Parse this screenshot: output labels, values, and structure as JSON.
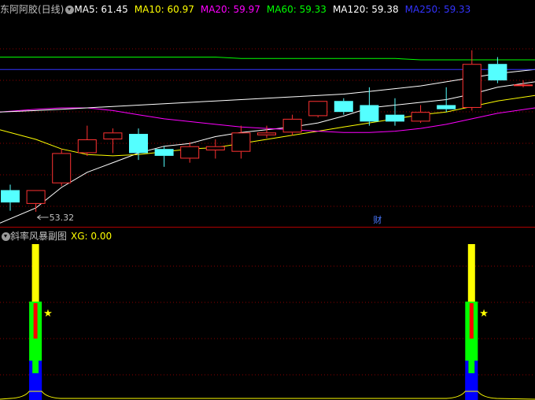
{
  "main_panel": {
    "title": "东阿阿胶(日线)",
    "ma_labels": [
      {
        "text": "MA5: 61.45",
        "color": "#ffffff"
      },
      {
        "text": "MA10: 60.97",
        "color": "#ffff00"
      },
      {
        "text": "MA20: 59.97",
        "color": "#ff00ff"
      },
      {
        "text": "MA60: 59.33",
        "color": "#00ff00"
      },
      {
        "text": "MA120: 59.38",
        "color": "#ffffff"
      },
      {
        "text": "MA250: 59.33",
        "color": "#3333ff"
      }
    ],
    "min_price_label": "53.32",
    "finance_marker": "财"
  },
  "sub_panel": {
    "title": "斜率风暴副图",
    "xg_label": "XG: 0.00"
  },
  "colors": {
    "up": "#ff3232",
    "down": "#54ffff",
    "grid": "#8b0000",
    "title": "#c0c0c0",
    "xg": "#ffff00"
  },
  "chart_data": {
    "type": "candlestick",
    "title": "东阿阿胶(日线)",
    "price_range": [
      52.4,
      67.5
    ],
    "min_label": 53.32,
    "candles": [
      {
        "o": 54.9,
        "h": 55.3,
        "l": 53.4,
        "c": 54.0
      },
      {
        "o": 53.9,
        "h": 54.9,
        "l": 53.32,
        "c": 54.9
      },
      {
        "o": 55.4,
        "h": 57.9,
        "l": 55.2,
        "c": 57.6
      },
      {
        "o": 57.6,
        "h": 59.6,
        "l": 57.4,
        "c": 58.6
      },
      {
        "o": 58.6,
        "h": 59.4,
        "l": 57.6,
        "c": 59.1
      },
      {
        "o": 59.0,
        "h": 59.4,
        "l": 57.1,
        "c": 57.6
      },
      {
        "o": 57.9,
        "h": 58.1,
        "l": 56.6,
        "c": 57.4
      },
      {
        "o": 57.2,
        "h": 58.4,
        "l": 56.9,
        "c": 58.1
      },
      {
        "o": 57.8,
        "h": 58.6,
        "l": 57.2,
        "c": 58.1
      },
      {
        "o": 57.7,
        "h": 59.6,
        "l": 57.2,
        "c": 59.1
      },
      {
        "o": 58.9,
        "h": 59.6,
        "l": 58.7,
        "c": 59.1
      },
      {
        "o": 59.1,
        "h": 60.4,
        "l": 58.9,
        "c": 60.1
      },
      {
        "o": 60.3,
        "h": 61.4,
        "l": 60.2,
        "c": 61.4
      },
      {
        "o": 61.4,
        "h": 61.6,
        "l": 60.4,
        "c": 60.6
      },
      {
        "o": 61.1,
        "h": 62.4,
        "l": 59.6,
        "c": 59.9
      },
      {
        "o": 60.4,
        "h": 61.6,
        "l": 59.6,
        "c": 59.9
      },
      {
        "o": 59.9,
        "h": 61.1,
        "l": 59.8,
        "c": 60.6
      },
      {
        "o": 61.1,
        "h": 62.4,
        "l": 60.6,
        "c": 60.8
      },
      {
        "o": 60.9,
        "h": 65.1,
        "l": 60.7,
        "c": 64.1
      },
      {
        "o": 64.1,
        "h": 64.6,
        "l": 62.7,
        "c": 62.9
      },
      {
        "o": 62.6,
        "h": 62.9,
        "l": 62.4,
        "c": 62.6
      }
    ],
    "ma": [
      {
        "name": "MA5",
        "color": "#ffffff",
        "values": [
          52.5,
          53.6,
          55.1,
          56.2,
          56.9,
          57.6,
          58.1,
          58.3,
          58.8,
          59.1,
          59.3,
          59.5,
          59.8,
          60.3,
          60.9,
          61.1,
          61.3,
          61.5,
          61.9,
          62.4,
          62.8
        ]
      },
      {
        "name": "MA10",
        "color": "#ffff00",
        "values": [
          59.3,
          58.6,
          57.9,
          57.5,
          57.4,
          57.5,
          57.7,
          57.9,
          58.0,
          58.3,
          58.6,
          58.9,
          59.2,
          59.5,
          59.8,
          60.1,
          60.4,
          60.6,
          61.0,
          61.4,
          61.8
        ]
      },
      {
        "name": "MA20",
        "color": "#ff00ff",
        "values": [
          60.6,
          60.8,
          60.9,
          60.9,
          60.7,
          60.4,
          60.1,
          59.9,
          59.7,
          59.5,
          59.4,
          59.3,
          59.2,
          59.1,
          59.1,
          59.2,
          59.4,
          59.7,
          60.1,
          60.5,
          60.9
        ]
      },
      {
        "name": "MA60",
        "color": "#00ff00",
        "values": [
          64.6,
          64.6,
          64.6,
          64.6,
          64.6,
          64.6,
          64.6,
          64.6,
          64.6,
          64.5,
          64.5,
          64.5,
          64.5,
          64.5,
          64.5,
          64.5,
          64.4,
          64.4,
          64.4,
          64.4,
          64.4
        ]
      },
      {
        "name": "MA120",
        "color": "#ffffff",
        "values": [
          60.6,
          60.7,
          60.8,
          60.9,
          61.0,
          61.1,
          61.2,
          61.3,
          61.4,
          61.5,
          61.6,
          61.7,
          61.8,
          61.9,
          62.1,
          62.3,
          62.5,
          62.8,
          63.1,
          63.4,
          63.7
        ]
      },
      {
        "name": "MA250",
        "color": "#3333ff",
        "values": [
          63.7,
          63.7,
          63.7,
          63.7,
          63.7,
          63.7,
          63.7,
          63.7,
          63.7,
          63.7,
          63.7,
          63.7,
          63.7,
          63.7,
          63.7,
          63.7,
          63.7,
          63.7,
          63.7,
          63.7,
          63.7
        ]
      }
    ],
    "finance_marker_index": 14,
    "signals": [
      {
        "index": 1,
        "star": true
      },
      {
        "index": 18,
        "star": true
      }
    ]
  }
}
